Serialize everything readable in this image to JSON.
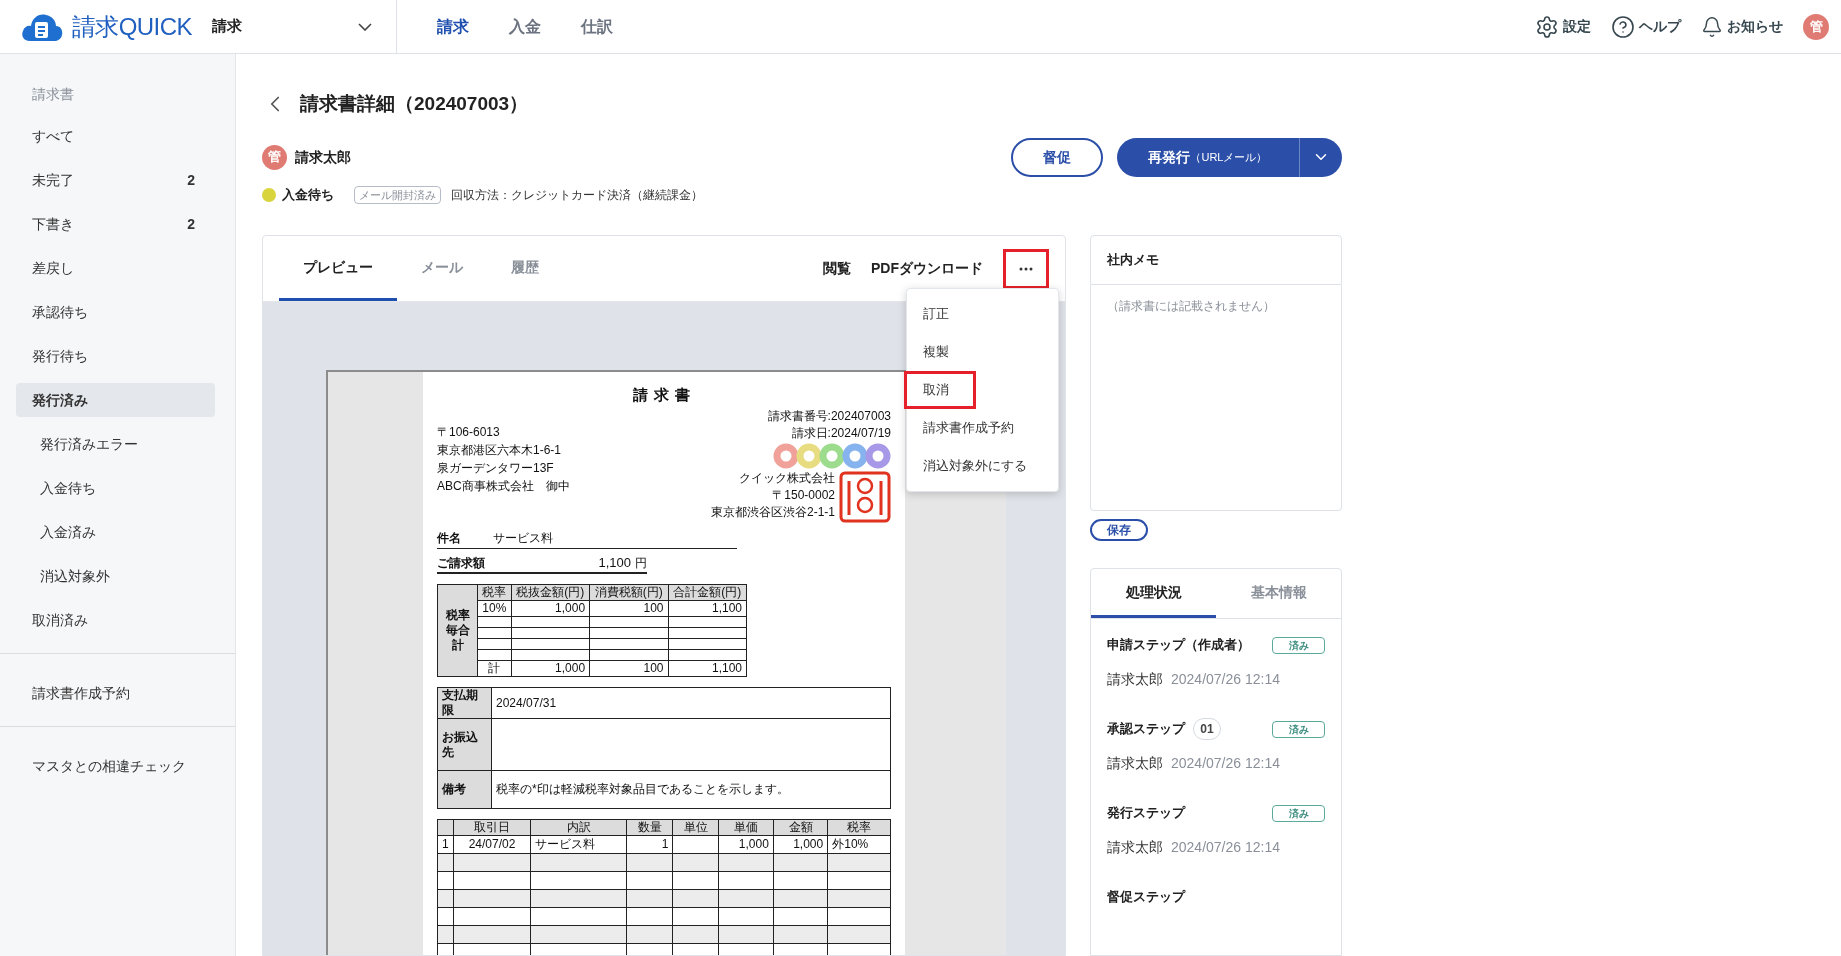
{
  "app": {
    "logo_text": "請求QUICK",
    "module_select": "請求",
    "nav": [
      {
        "label": "請求",
        "selected": true
      },
      {
        "label": "入金",
        "selected": false
      },
      {
        "label": "仕訳",
        "selected": false
      }
    ],
    "utilities": [
      {
        "kind": "settings",
        "label": "設定"
      },
      {
        "kind": "help",
        "label": "ヘルプ"
      },
      {
        "kind": "bell",
        "label": "お知らせ"
      }
    ],
    "avatar": "管"
  },
  "sidebar": {
    "groups": [
      {
        "heading": "請求書",
        "items": [
          {
            "label": "すべて",
            "selected": false
          },
          {
            "label": "未完了",
            "count": "2",
            "selected": false
          },
          {
            "label": "下書き",
            "count": "2",
            "selected": false
          },
          {
            "label": "差戻し",
            "selected": false
          },
          {
            "label": "承認待ち",
            "selected": false
          },
          {
            "label": "発行待ち",
            "selected": false
          },
          {
            "label": "発行済み",
            "selected": true,
            "children": [
              {
                "label": "発行済みエラー",
                "selected": false
              },
              {
                "label": "入金待ち",
                "selected": false
              },
              {
                "label": "入金済み",
                "selected": false
              },
              {
                "label": "消込対象外",
                "selected": false
              }
            ]
          },
          {
            "label": "取消済み",
            "selected": false
          }
        ]
      },
      {
        "items": [
          {
            "label": "請求書作成予約",
            "selected": false
          }
        ]
      },
      {
        "items": [
          {
            "label": "マスタとの相違チェック",
            "selected": false
          }
        ]
      }
    ]
  },
  "page": {
    "title": "請求書詳細（202407003）",
    "owner": {
      "avatar": "管",
      "name": "請求太郎"
    },
    "buttons": {
      "remind": "督促",
      "reissue": "再発行",
      "reissue_sub": "（URLメール）"
    },
    "status": {
      "label": "入金待ち",
      "color": "#d8d43c"
    },
    "mail_badge": "メール開封済み",
    "collection": "回収方法：クレジットカード決済（継続課金）"
  },
  "preview": {
    "tabs": [
      {
        "label": "プレビュー",
        "selected": true
      },
      {
        "label": "メール",
        "selected": false
      },
      {
        "label": "履歴",
        "selected": false
      }
    ],
    "actions": [
      "閲覧",
      "PDFダウンロード"
    ],
    "more_highlighted": true,
    "menu": [
      {
        "label": "訂正",
        "highlighted": false
      },
      {
        "label": "複製",
        "highlighted": false
      },
      {
        "label": "取消",
        "highlighted": true
      },
      {
        "label": "請求書作成予約",
        "highlighted": false
      },
      {
        "label": "消込対象外にする",
        "highlighted": false
      }
    ]
  },
  "document": {
    "title": "請求書",
    "number": "請求書番号:202407003",
    "date": "請求日:2024/07/19",
    "recipient": [
      "〒106-6013",
      "東京都港区六本木1-6-1",
      "泉ガーデンタワー13F",
      "ABC商事株式会社　御中"
    ],
    "issuer": [
      "クイック株式会社",
      "〒150-0002",
      "東京都渋谷区渋谷2-1-1"
    ],
    "subject_label": "件名",
    "subject": "サービス料",
    "amount_label": "ご請求額",
    "amount": "1,100",
    "currency": "円",
    "tax_table": {
      "side_label": "税率毎合計",
      "headers": [
        "税率",
        "税抜金額(円)",
        "消費税額(円)",
        "合計金額(円)"
      ],
      "rows": [
        [
          "10%",
          "1,000",
          "100",
          "1,100"
        ]
      ],
      "total": [
        "計",
        "1,000",
        "100",
        "1,100"
      ]
    },
    "info": [
      {
        "label": "支払期限",
        "value": "2024/07/31"
      },
      {
        "label": "お振込先"
      },
      {
        "label": "備考",
        "value": "税率の*印は軽減税率対象品目であることを示します。"
      }
    ],
    "items": {
      "headers": [
        "取引日",
        "内訳",
        "数量",
        "単位",
        "単価",
        "金額",
        "税率"
      ],
      "rows": [
        {
          "no": "1",
          "date": "24/07/02",
          "description": "サービス料",
          "quantity": "1",
          "unit_price": "1,000",
          "amount": "1,000",
          "tax": "外10%"
        }
      ]
    }
  },
  "memo": {
    "title": "社内メモ",
    "placeholder": "（請求書には記載されません）",
    "save": "保存"
  },
  "progress": {
    "tabs": [
      {
        "label": "処理状況",
        "selected": true
      },
      {
        "label": "基本情報",
        "selected": false
      }
    ],
    "steps": [
      {
        "title": "申請ステップ（作成者）",
        "badge": "済み",
        "person": "請求太郎",
        "time": "2024/07/26 12:14"
      },
      {
        "title": "承認ステップ",
        "number": "01",
        "badge": "済み",
        "person": "請求太郎",
        "time": "2024/07/26 12:14"
      },
      {
        "title": "発行ステップ",
        "badge": "済み",
        "person": "請求太郎",
        "time": "2024/07/26 12:14"
      },
      {
        "title": "督促ステップ"
      }
    ]
  }
}
